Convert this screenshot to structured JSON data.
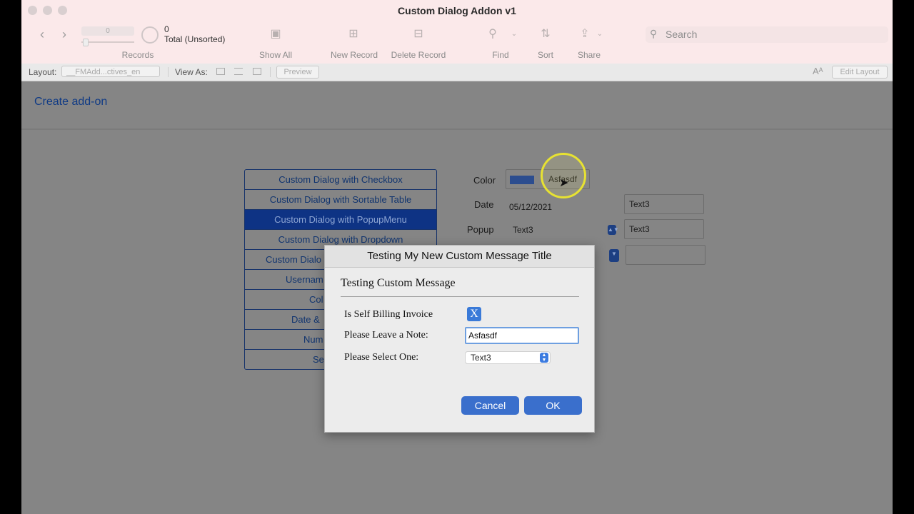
{
  "window": {
    "title": "Custom Dialog Addon v1"
  },
  "toolbar": {
    "record_slider_value": "0",
    "found_count": "0",
    "total_label": "Total (Unsorted)",
    "records_label": "Records",
    "show_all_label": "Show All",
    "new_record_label": "New Record",
    "delete_record_label": "Delete Record",
    "find_label": "Find",
    "sort_label": "Sort",
    "share_label": "Share",
    "search_placeholder": "Search"
  },
  "layout_bar": {
    "layout_label": "Layout:",
    "layout_value": "__FMAdd...ctives_en",
    "view_as_label": "View As:",
    "preview_label": "Preview",
    "edit_layout_label": "Edit Layout",
    "font_size_icon": "Aᴬ"
  },
  "content": {
    "header_title": "Create add-on",
    "buttons": [
      "Custom Dialog with Checkbox",
      "Custom Dialog with Sortable Table",
      "Custom Dialog with PopupMenu",
      "Custom Dialog with Dropdown",
      "Custom Dialo",
      "Usernam",
      "Col",
      "Date &",
      "Num",
      "Se"
    ],
    "active_button_index": 2,
    "fields": {
      "color_label": "Color",
      "color_value": "Asfasdf",
      "date_label": "Date",
      "date_value": "05/12/2021",
      "popup_label": "Popup",
      "popup_value": "Text3",
      "text3_a": "Text3",
      "text3_b": "Text3"
    }
  },
  "dialog": {
    "title": "Testing My New Custom Message Title",
    "message": "Testing Custom Message",
    "checkbox_label": "Is Self Billing Invoice",
    "checkbox_mark": "X",
    "note_label": "Please Leave a Note:",
    "note_value": "Asfasdf",
    "select_label": "Please Select One:",
    "select_value": "Text3",
    "cancel_label": "Cancel",
    "ok_label": "OK"
  },
  "colors": {
    "titlebar": "#fbe9ea",
    "active_button": "#0e3384",
    "dialog_button": "#3a6fcc",
    "cursor_highlight": "#e7e232"
  }
}
